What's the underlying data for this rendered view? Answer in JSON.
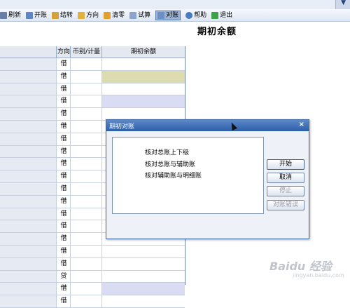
{
  "toolbar": {
    "items": [
      {
        "label": "刷新",
        "icon": "refresh-icon",
        "color": "#6a7fa8"
      },
      {
        "label": "开账",
        "icon": "open-account-icon",
        "color": "#5f85c9"
      },
      {
        "label": "结转",
        "icon": "carryover-icon",
        "color": "#d3a23a"
      },
      {
        "label": "方向",
        "icon": "direction-icon",
        "color": "#e0b040"
      },
      {
        "label": "清零",
        "icon": "clear-icon",
        "color": "#e0a030"
      },
      {
        "label": "试算",
        "icon": "trial-balance-icon",
        "color": "#8aa4cc"
      },
      {
        "label": "对账",
        "icon": "reconcile-icon",
        "color": "#6c8fc4"
      },
      {
        "label": "帮助",
        "icon": "help-icon",
        "color": "#4a7ac0"
      },
      {
        "label": "退出",
        "icon": "exit-icon",
        "color": "#3fa04a"
      }
    ]
  },
  "page": {
    "title": "期初余额"
  },
  "table": {
    "headers": {
      "direction": "方向",
      "currency_qty": "币别/计量",
      "opening_balance": "期初余额"
    },
    "rows": [
      {
        "direction": "借"
      },
      {
        "direction": "借"
      },
      {
        "direction": "借"
      },
      {
        "direction": "借"
      },
      {
        "direction": "借"
      },
      {
        "direction": "借"
      },
      {
        "direction": "借"
      },
      {
        "direction": "借"
      },
      {
        "direction": "借"
      },
      {
        "direction": "借"
      },
      {
        "direction": "借"
      },
      {
        "direction": "借"
      },
      {
        "direction": "借"
      },
      {
        "direction": "借"
      },
      {
        "direction": "借"
      },
      {
        "direction": "借"
      },
      {
        "direction": "借"
      },
      {
        "direction": "贷"
      },
      {
        "direction": "借"
      },
      {
        "direction": "借"
      }
    ]
  },
  "dialog": {
    "title": "期初对账",
    "checks": [
      "核对总账上下级",
      "核对总账与辅助账",
      "核对辅助账与明细账"
    ],
    "buttons": {
      "start": "开始",
      "cancel": "取消",
      "stop": "停止",
      "errors": "对账错误"
    }
  },
  "watermark": {
    "brand": "Baidu 经验",
    "url": "jingyan.baidu.com"
  }
}
